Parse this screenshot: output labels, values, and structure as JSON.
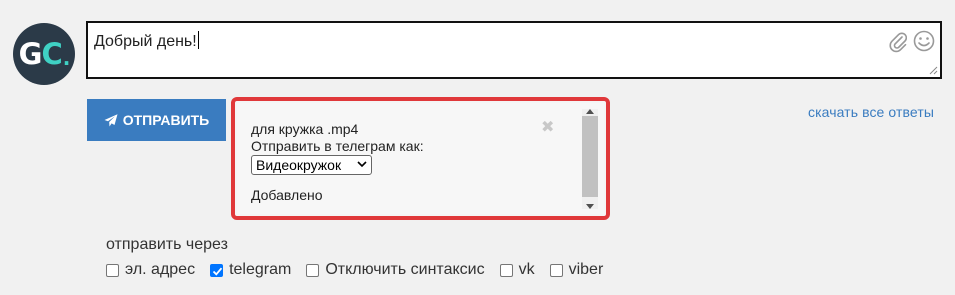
{
  "avatar": {
    "letter_g": "G",
    "letter_c": "C",
    "dot": "."
  },
  "message": {
    "text": "Добрый день!"
  },
  "icons": {
    "attach": "paperclip-icon",
    "emoji": "smile-icon",
    "send": "paper-plane-icon"
  },
  "send_button": {
    "label": "ОТПРАВИТЬ"
  },
  "download_link": "скачать все ответы",
  "attachment": {
    "file_name": "для кружка .mp4",
    "send_as_label": "Отправить в телеграм как:",
    "send_as_value": "Видеокружок",
    "status": "Добавлено",
    "close": "✖"
  },
  "send_via": {
    "label": "отправить через",
    "options": [
      {
        "label": "эл. адрес",
        "checked": false
      },
      {
        "label": "telegram",
        "checked": true
      },
      {
        "label": "Отключить синтаксис",
        "checked": false
      },
      {
        "label": "vk",
        "checked": false
      },
      {
        "label": "viber",
        "checked": false
      }
    ]
  },
  "colors": {
    "accent": "#3a7cc0",
    "highlight_border": "#e0383a",
    "avatar_bg": "#2b3a48",
    "avatar_teal": "#3fd1c4"
  }
}
